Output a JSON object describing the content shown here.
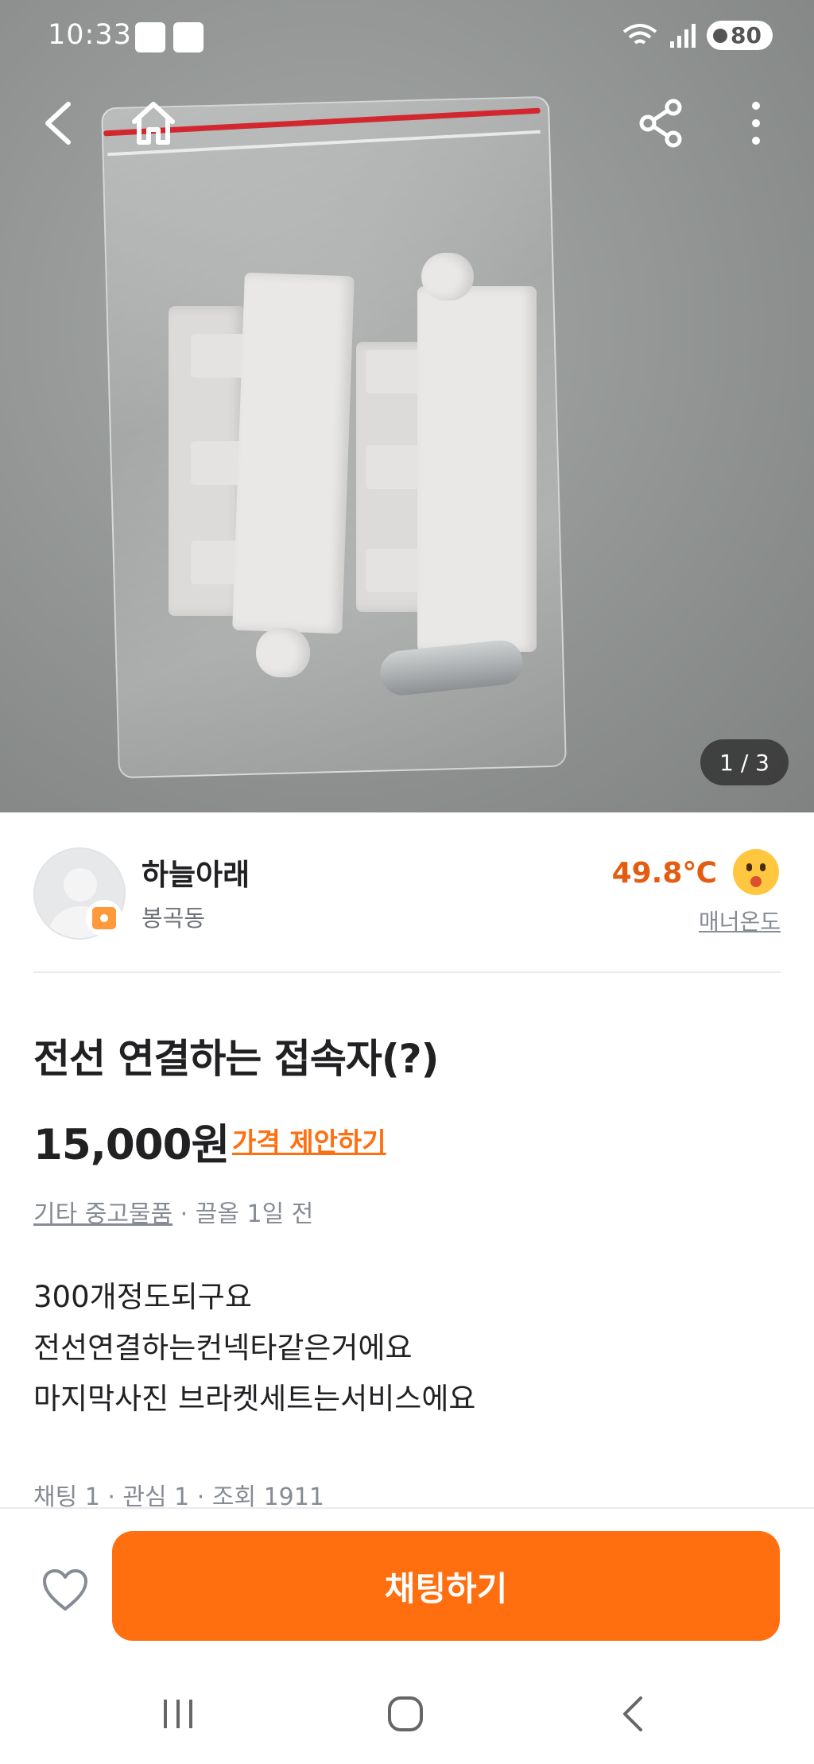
{
  "status_bar": {
    "time": "10:33",
    "battery": "80",
    "icons": [
      "notification-icon",
      "app-icon",
      "wifi-icon",
      "signal-icon",
      "battery-icon"
    ]
  },
  "top_nav": {
    "icons": [
      "back-arrow-icon",
      "home-icon",
      "share-icon",
      "more-vertical-icon"
    ]
  },
  "photo": {
    "pager": "1 / 3"
  },
  "seller": {
    "name": "하늘아래",
    "location": "봉곡동",
    "temperature": "49.8℃",
    "manner_label": "매너온도",
    "temperature_color": "#e35d11"
  },
  "product": {
    "title": "전선 연결하는 접속자(?)",
    "price": "15,000원",
    "offer_label": "가격 제안하기",
    "category": "기타 중고물품",
    "time_ago": " · 끌올 1일 전",
    "description": [
      "300개정도되구요",
      "전선연결하는컨넥타같은거에요",
      "마지막사진 브라켓세트는서비스에요"
    ],
    "stats": "채팅 1 · 관심 1 · 조회 1911"
  },
  "action_bar": {
    "chat_button": "채팅하기",
    "accent_color": "#ff6f0f"
  },
  "system_nav": {
    "icons": [
      "recent-apps-icon",
      "home-circle-icon",
      "system-back-icon"
    ]
  }
}
